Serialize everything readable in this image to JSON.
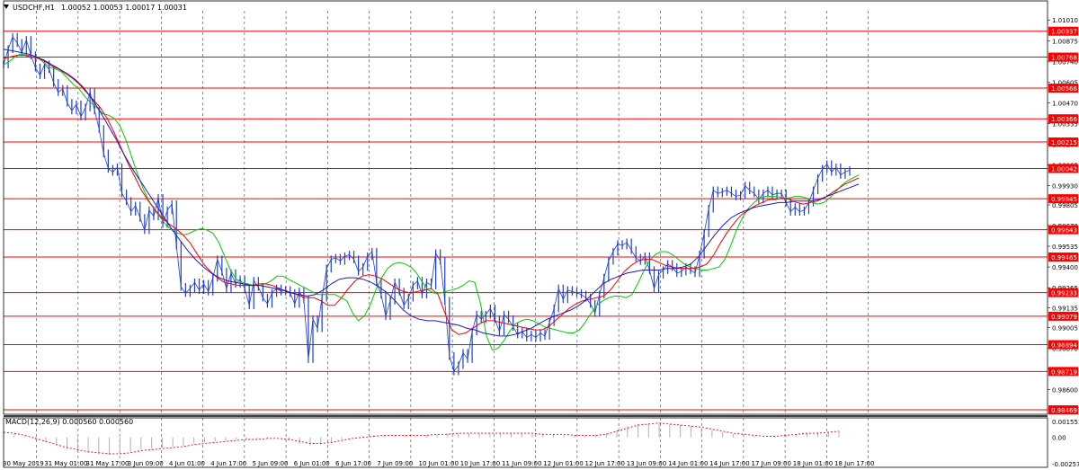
{
  "window": {
    "symbol_label": "USDCHF,H1",
    "ohlc_label": "1.00052 1.00053 1.00017 1.00031"
  },
  "macd_label": "MACD(12,26,9) 0.000560 0.000560",
  "colors": {
    "background": "#ffffff",
    "grid": "#000000",
    "candles": "#1e3fd0",
    "level_line": "#ff0000",
    "ma_fast": "#00cc00",
    "ma_mid": "#ff0000",
    "ma_slow": "#1a1acc",
    "axis_text": "#000000",
    "level_tag_bg": "#ff0000",
    "level_tag_text": "#ffffff",
    "macd_hist": "#b0b0b0",
    "macd_signal": "#ff0000"
  },
  "chart_data": {
    "type": "line",
    "price_axis": {
      "ylim": [
        0.9844,
        1.0107
      ],
      "tick_labels": [
        "1.01010",
        "1.00875",
        "1.00740",
        "1.00605",
        "1.00470",
        "1.00335",
        "1.00200",
        "1.00065",
        "0.99930",
        "0.99805",
        "0.99670",
        "0.99535",
        "0.99400",
        "0.99265",
        "0.99135",
        "0.99005",
        "0.98870",
        "0.98735",
        "0.98600"
      ]
    },
    "x_labels": [
      "30 May 2019",
      "31 May 01:00",
      "31 May 17:00",
      "3 Jun 09:00",
      "4 Jun 01:00",
      "4 Jun 17:00",
      "5 Jun 09:00",
      "6 Jun 01:00",
      "6 Jun 17:00",
      "7 Jun 09:00",
      "10 Jun 01:00",
      "10 Jun 17:00",
      "11 Jun 09:00",
      "12 Jun 01:00",
      "12 Jun 17:00",
      "13 Jun 09:00",
      "14 Jun 01:00",
      "14 Jun 17:00",
      "17 Jun 09:00",
      "18 Jun 01:00",
      "18 Jun 17:00"
    ],
    "horizontal_levels": [
      1.00937,
      1.00768,
      1.00566,
      1.00366,
      1.00215,
      1.00042,
      0.99845,
      0.99643,
      0.99465,
      0.99233,
      0.99079,
      0.98894,
      0.98719,
      0.98469
    ],
    "price_series": {
      "name": "USDCHF",
      "values": [
        1.0072,
        1.0082,
        1.009,
        1.0086,
        1.008,
        1.0088,
        1.0078,
        1.007,
        1.0065,
        1.0072,
        1.0069,
        1.006,
        1.0054,
        1.0056,
        1.0047,
        1.0042,
        1.0046,
        1.0038,
        1.0044,
        1.0054,
        1.0042,
        1.003,
        1.0014,
        1.0004,
        1.0002,
        1.0005,
        0.9988,
        0.9983,
        0.9976,
        0.998,
        0.9972,
        0.9964,
        0.9977,
        0.9973,
        0.9985,
        0.9968,
        0.9977,
        0.9981,
        0.9954,
        0.9927,
        0.9923,
        0.9926,
        0.993,
        0.9925,
        0.9929,
        0.9924,
        0.9933,
        0.9945,
        0.9937,
        0.9926,
        0.9936,
        0.9929,
        0.9932,
        0.9926,
        0.9915,
        0.9931,
        0.9927,
        0.992,
        0.9916,
        0.9923,
        0.9926,
        0.9924,
        0.9925,
        0.9923,
        0.9916,
        0.9924,
        0.9919,
        0.988,
        0.9906,
        0.99,
        0.992,
        0.9939,
        0.9945,
        0.9946,
        0.9944,
        0.9947,
        0.9948,
        0.9945,
        0.9937,
        0.994,
        0.9947,
        0.995,
        0.993,
        0.9922,
        0.9908,
        0.9918,
        0.993,
        0.9924,
        0.9915,
        0.992,
        0.9928,
        0.9931,
        0.9922,
        0.993,
        0.9928,
        0.9949,
        0.9944,
        0.9918,
        0.9882,
        0.9872,
        0.9876,
        0.9884,
        0.988,
        0.9898,
        0.9909,
        0.9906,
        0.9909,
        0.9913,
        0.9906,
        0.9898,
        0.9909,
        0.9906,
        0.9901,
        0.9896,
        0.9898,
        0.9894,
        0.9896,
        0.9894,
        0.9897,
        0.9895,
        0.9904,
        0.9913,
        0.9926,
        0.9919,
        0.9925,
        0.9924,
        0.9923,
        0.9922,
        0.992,
        0.9916,
        0.991,
        0.9922,
        0.9933,
        0.9944,
        0.995,
        0.9955,
        0.9954,
        0.9956,
        0.9951,
        0.9946,
        0.9944,
        0.9947,
        0.9938,
        0.9926,
        0.9935,
        0.9938,
        0.9942,
        0.994,
        0.9936,
        0.9937,
        0.994,
        0.9938,
        0.9936,
        0.9948,
        0.9962,
        0.9978,
        0.999,
        0.9988,
        0.9989,
        0.999,
        0.9988,
        0.9986,
        0.9987,
        0.9993,
        0.999,
        0.9988,
        0.9984,
        0.9988,
        0.999,
        0.9987,
        0.9988,
        0.9988,
        0.9982,
        0.9976,
        0.9979,
        0.9976,
        0.9977,
        0.9982,
        0.999,
        0.9998,
        1.0004,
        1.0007,
        1.0002,
        1.0005,
        1.0,
        1.0002,
        1.00031
      ]
    },
    "moving_averages": [
      {
        "name": "ma_fast",
        "color": "#00cc00",
        "values": [
          1.0072,
          1.0074,
          1.0077,
          1.0079,
          1.0078,
          1.0078,
          1.0076,
          1.0073,
          1.007,
          1.0069,
          1.0067,
          1.0063,
          1.0059,
          1.0056,
          1.0051,
          1.0047,
          1.0044,
          1.004,
          1.0039,
          1.0037,
          1.0032,
          1.0023,
          1.0012,
          1.0001,
          0.9991,
          0.9983,
          0.9977,
          0.9972,
          0.9967,
          0.9964,
          0.9962,
          0.9961,
          0.9962,
          0.9964,
          0.9965,
          0.9964,
          0.9962,
          0.9956,
          0.9947,
          0.9938,
          0.9932,
          0.993,
          0.9929,
          0.9928,
          0.9928,
          0.9929,
          0.9931,
          0.9934,
          0.9934,
          0.9932,
          0.993,
          0.9928,
          0.9926,
          0.9924,
          0.9922,
          0.9922,
          0.9922,
          0.9922,
          0.992,
          0.9918,
          0.991,
          0.9905,
          0.9908,
          0.9915,
          0.9925,
          0.9933,
          0.9939,
          0.9942,
          0.9943,
          0.9942,
          0.994,
          0.9936,
          0.993,
          0.9925,
          0.9923,
          0.9923,
          0.9924,
          0.9925,
          0.9926,
          0.9928,
          0.9931,
          0.993,
          0.9916,
          0.9895,
          0.9886,
          0.9887,
          0.9892,
          0.9898,
          0.9903,
          0.9905,
          0.9906,
          0.9905,
          0.9903,
          0.9901,
          0.99,
          0.9899,
          0.9898,
          0.9897,
          0.9897,
          0.9899,
          0.9904,
          0.991,
          0.9915,
          0.9918,
          0.992,
          0.9921,
          0.9921,
          0.992,
          0.9922,
          0.9929,
          0.9937,
          0.9944,
          0.9948,
          0.995,
          0.995,
          0.9948,
          0.9945,
          0.9942,
          0.994,
          0.9939,
          0.9938,
          0.9938,
          0.9939,
          0.994,
          0.9945,
          0.9954,
          0.9964,
          0.9972,
          0.9978,
          0.9982,
          0.9985,
          0.9986,
          0.9986,
          0.9986,
          0.9985,
          0.9985,
          0.9986,
          0.9986,
          0.9985,
          0.9982,
          0.9981,
          0.9982,
          0.9985,
          0.9989,
          0.9993,
          0.9996,
          0.9998,
          1.0
        ]
      },
      {
        "name": "ma_mid",
        "color": "#ff0000",
        "values": [
          1.0076,
          1.0077,
          1.0078,
          1.0078,
          1.0077,
          1.0076,
          1.0074,
          1.0071,
          1.0069,
          1.0066,
          1.0063,
          1.0059,
          1.0054,
          1.0049,
          1.0044,
          1.0037,
          1.0028,
          1.0018,
          1.0008,
          0.9999,
          0.999,
          0.9983,
          0.9977,
          0.9972,
          0.9968,
          0.9965,
          0.9961,
          0.9956,
          0.9949,
          0.9942,
          0.9937,
          0.9933,
          0.993,
          0.9929,
          0.9928,
          0.9928,
          0.9928,
          0.9929,
          0.9929,
          0.9928,
          0.9926,
          0.9924,
          0.9923,
          0.9921,
          0.992,
          0.992,
          0.9918,
          0.9915,
          0.9915,
          0.992,
          0.9926,
          0.9931,
          0.9934,
          0.9935,
          0.9934,
          0.9932,
          0.9929,
          0.9926,
          0.9924,
          0.9923,
          0.9924,
          0.9925,
          0.9926,
          0.9922,
          0.991,
          0.9899,
          0.9896,
          0.9897,
          0.99,
          0.9903,
          0.9905,
          0.9905,
          0.9904,
          0.9903,
          0.9902,
          0.9901,
          0.99,
          0.9899,
          0.9899,
          0.9901,
          0.9905,
          0.9909,
          0.9913,
          0.9916,
          0.9918,
          0.9919,
          0.992,
          0.9921,
          0.9925,
          0.9931,
          0.9937,
          0.9941,
          0.9944,
          0.9945,
          0.9945,
          0.9943,
          0.9941,
          0.994,
          0.9939,
          0.9939,
          0.9939,
          0.994,
          0.9942,
          0.9948,
          0.9956,
          0.9963,
          0.9969,
          0.9974,
          0.9977,
          0.998,
          0.9982,
          0.9984,
          0.9984,
          0.9985,
          0.9984,
          0.9982,
          0.9981,
          0.9982,
          0.9983,
          0.9985,
          0.9988,
          0.9991,
          0.9994,
          0.9996,
          0.9998
        ]
      },
      {
        "name": "ma_slow",
        "color": "#1a1acc",
        "values": [
          1.0082,
          1.0081,
          1.008,
          1.0079,
          1.0077,
          1.0075,
          1.0072,
          1.0069,
          1.0066,
          1.0062,
          1.0057,
          1.005,
          1.0042,
          1.0033,
          1.0024,
          1.0014,
          1.0005,
          0.9997,
          0.9989,
          0.9981,
          0.9973,
          0.9965,
          0.9958,
          0.9951,
          0.9945,
          0.994,
          0.9936,
          0.9933,
          0.9931,
          0.993,
          0.9929,
          0.9928,
          0.9928,
          0.9927,
          0.9926,
          0.9925,
          0.9923,
          0.9922,
          0.9921,
          0.9922,
          0.9925,
          0.9929,
          0.9932,
          0.9933,
          0.9933,
          0.9932,
          0.993,
          0.9927,
          0.9923,
          0.9918,
          0.9912,
          0.9908,
          0.9906,
          0.9905,
          0.9905,
          0.9904,
          0.9903,
          0.9902,
          0.99,
          0.9899,
          0.9897,
          0.9896,
          0.9895,
          0.9895,
          0.9896,
          0.9898,
          0.99,
          0.9903,
          0.9906,
          0.9908,
          0.991,
          0.9912,
          0.9915,
          0.9919,
          0.9924,
          0.9929,
          0.9932,
          0.9934,
          0.9936,
          0.9937,
          0.9938,
          0.9938,
          0.9938,
          0.9939,
          0.9939,
          0.994,
          0.9942,
          0.9947,
          0.9954,
          0.9961,
          0.9967,
          0.9972,
          0.9975,
          0.9977,
          0.9979,
          0.998,
          0.9981,
          0.9982,
          0.9982,
          0.9983,
          0.9983,
          0.9983,
          0.9984,
          0.9986,
          0.9988,
          0.999,
          0.9992,
          0.9994
        ]
      }
    ],
    "macd": {
      "ylim": [
        -0.00257,
        0.00155
      ],
      "tick_labels": [
        "0.001553",
        "0.00",
        "-0.002571"
      ],
      "histogram": [
        0.0004,
        0.0003,
        0.0001,
        -0.0002,
        -0.0005,
        -0.0008,
        -0.0011,
        -0.0013,
        -0.0015,
        -0.0016,
        -0.0017,
        -0.0016,
        -0.0014,
        -0.0012,
        -0.0011,
        -0.001,
        -0.0009,
        -0.0008,
        -0.0006,
        -0.0005,
        -0.0004,
        -0.0003,
        -0.0002,
        -0.0002,
        -0.0001,
        -0.0001,
        0.0,
        -0.0003,
        -0.0006,
        -0.0008,
        -0.0007,
        -0.0005,
        -0.0002,
        0.0,
        0.0001,
        0.0002,
        0.0002,
        0.0002,
        0.0002,
        0.0001,
        0.0002,
        0.0003,
        0.0004,
        0.0004,
        0.0004,
        0.0004,
        0.0004,
        0.0004,
        0.0004,
        0.0004,
        0.0003,
        0.0003,
        0.0003,
        0.0002,
        0.0002,
        0.0002,
        0.0002,
        0.0004,
        0.0007,
        0.0011,
        0.0013,
        0.0014,
        0.0014,
        0.0013,
        0.0012,
        0.0011,
        0.0009,
        0.0007,
        0.0005,
        0.0003,
        0.0002,
        0.0001,
        0.0,
        0.0001,
        0.0002,
        0.0003,
        0.0004,
        0.0005,
        0.0005,
        0.0006
      ],
      "signal": [
        0.0005,
        0.0004,
        0.0002,
        -0.0001,
        -0.0004,
        -0.0007,
        -0.001,
        -0.0012,
        -0.0014,
        -0.0015,
        -0.0016,
        -0.0016,
        -0.0015,
        -0.0013,
        -0.0012,
        -0.0011,
        -0.001,
        -0.0009,
        -0.0007,
        -0.0006,
        -0.0005,
        -0.0004,
        -0.0003,
        -0.0002,
        -0.0002,
        -0.0001,
        -0.0001,
        -0.0002,
        -0.0004,
        -0.0006,
        -0.0006,
        -0.0005,
        -0.0003,
        -0.0001,
        0.0,
        0.0001,
        0.0002,
        0.0002,
        0.0002,
        0.0002,
        0.0002,
        0.0003,
        0.0003,
        0.0004,
        0.0004,
        0.0004,
        0.0004,
        0.0004,
        0.0004,
        0.0004,
        0.0004,
        0.0003,
        0.0003,
        0.0003,
        0.0002,
        0.0002,
        0.0002,
        0.0003,
        0.0006,
        0.0009,
        0.0012,
        0.0013,
        0.0014,
        0.0013,
        0.0012,
        0.0011,
        0.001,
        0.0008,
        0.0006,
        0.0004,
        0.0003,
        0.0002,
        0.0001,
        0.0001,
        0.0002,
        0.0003,
        0.0004,
        0.0004,
        0.0005,
        0.0006
      ]
    }
  }
}
